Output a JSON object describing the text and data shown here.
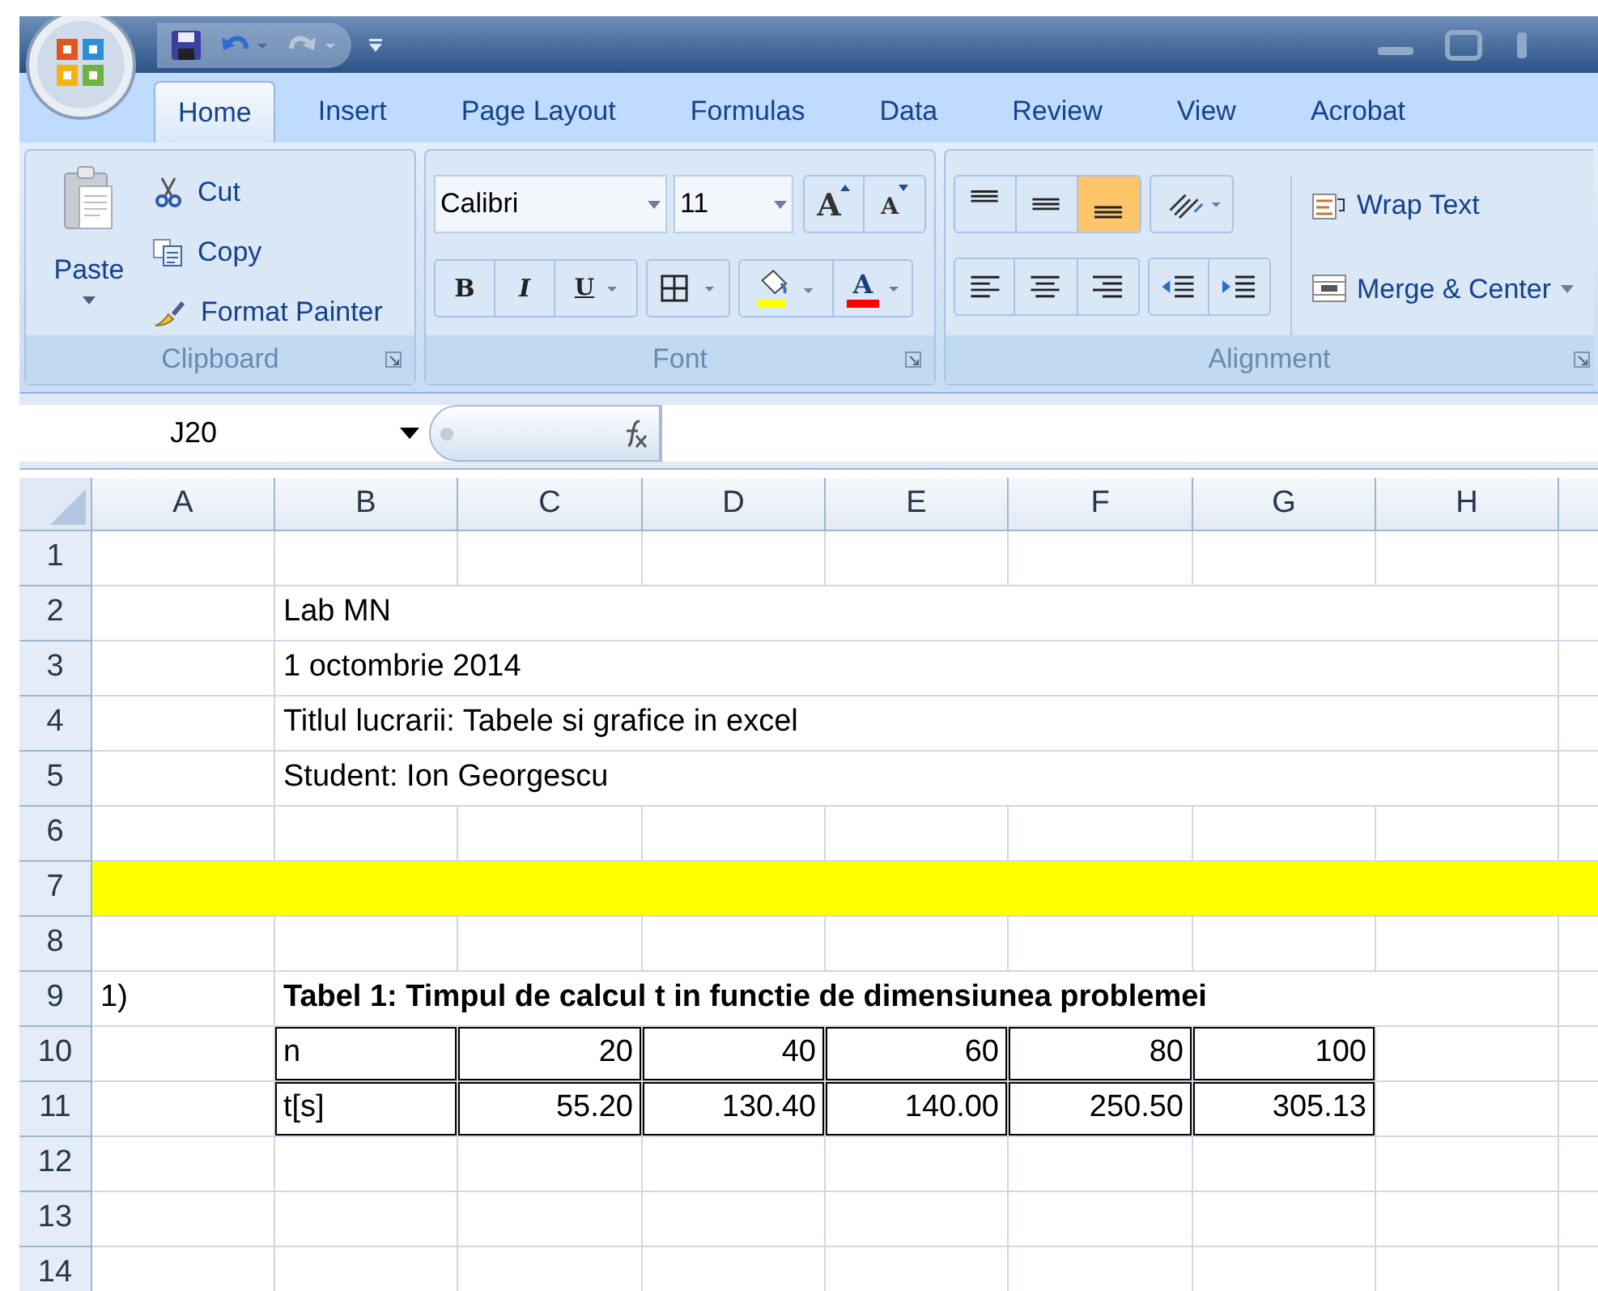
{
  "quick_access": [
    {
      "kind": "save",
      "disabled": false
    },
    {
      "kind": "undo",
      "disabled": false
    },
    {
      "kind": "redo",
      "disabled": true
    }
  ],
  "tabs": [
    {
      "label": "Home",
      "selected": true
    },
    {
      "label": "Insert",
      "selected": false
    },
    {
      "label": "Page Layout",
      "selected": false
    },
    {
      "label": "Formulas",
      "selected": false
    },
    {
      "label": "Data",
      "selected": false
    },
    {
      "label": "Review",
      "selected": false
    },
    {
      "label": "View",
      "selected": false
    },
    {
      "label": "Acrobat",
      "selected": false
    }
  ],
  "clipboard": {
    "title": "Clipboard",
    "paste": "Paste",
    "items": [
      {
        "kind": "cut",
        "label": "Cut"
      },
      {
        "kind": "copy",
        "label": "Copy"
      },
      {
        "kind": "painter",
        "label": "Format Painter"
      }
    ]
  },
  "font": {
    "title": "Font",
    "font_name": "Calibri",
    "font_size": "11",
    "grow": "A",
    "shrink": "A",
    "bold": "B",
    "italic": "I",
    "underline": "U",
    "font_color": "A"
  },
  "alignment": {
    "title": "Alignment",
    "vertical": [
      {
        "kind": "top",
        "selected": false
      },
      {
        "kind": "middle",
        "selected": false
      },
      {
        "kind": "bottom",
        "selected": true
      }
    ],
    "wrap_text": "Wrap Text",
    "merge_center": "Merge & Center"
  },
  "formula_bar": {
    "name_box": "J20"
  },
  "sheet": {
    "columns": [
      "A",
      "B",
      "C",
      "D",
      "E",
      "F",
      "G",
      "H"
    ],
    "rows": [
      {
        "header": "1",
        "highlighted": false,
        "cells": {}
      },
      {
        "header": "2",
        "highlighted": false,
        "cells": {
          "B": {
            "text": "Lab MN",
            "kind": "text"
          }
        }
      },
      {
        "header": "3",
        "highlighted": false,
        "cells": {
          "B": {
            "text": "1 octombrie 2014",
            "kind": "text"
          }
        }
      },
      {
        "header": "4",
        "highlighted": false,
        "cells": {
          "B": {
            "text": "Titlul lucrarii: Tabele si grafice in excel",
            "kind": "text"
          }
        }
      },
      {
        "header": "5",
        "highlighted": false,
        "cells": {
          "B": {
            "text": "Student: Ion Georgescu",
            "kind": "text"
          }
        }
      },
      {
        "header": "6",
        "highlighted": false,
        "cells": {}
      },
      {
        "header": "7",
        "highlighted": true,
        "cells": {}
      },
      {
        "header": "8",
        "highlighted": false,
        "cells": {}
      },
      {
        "header": "9",
        "highlighted": false,
        "cells": {
          "A": {
            "text": "1)",
            "kind": "text"
          },
          "B": {
            "text": "Tabel 1: Timpul de calcul t in functie de dimensiunea problemei",
            "kind": "text",
            "bold": true
          }
        }
      },
      {
        "header": "10",
        "highlighted": false,
        "cells": {
          "B": {
            "text": "n",
            "kind": "text",
            "boxed": true
          },
          "C": {
            "text": "20",
            "kind": "number",
            "boxed": true
          },
          "D": {
            "text": "40",
            "kind": "number",
            "boxed": true
          },
          "E": {
            "text": "60",
            "kind": "number",
            "boxed": true
          },
          "F": {
            "text": "80",
            "kind": "number",
            "boxed": true
          },
          "G": {
            "text": "100",
            "kind": "number",
            "boxed": true
          }
        }
      },
      {
        "header": "11",
        "highlighted": false,
        "cells": {
          "B": {
            "text": "t[s]",
            "kind": "text",
            "boxed": true
          },
          "C": {
            "text": "55.20",
            "kind": "number",
            "boxed": true
          },
          "D": {
            "text": "130.40",
            "kind": "number",
            "boxed": true
          },
          "E": {
            "text": "140.00",
            "kind": "number",
            "boxed": true
          },
          "F": {
            "text": "250.50",
            "kind": "number",
            "boxed": true
          },
          "G": {
            "text": "305.13",
            "kind": "number",
            "boxed": true
          }
        }
      },
      {
        "header": "12",
        "highlighted": false,
        "cells": {}
      },
      {
        "header": "13",
        "highlighted": false,
        "cells": {}
      },
      {
        "header": "14",
        "highlighted": false,
        "cells": {}
      }
    ]
  }
}
